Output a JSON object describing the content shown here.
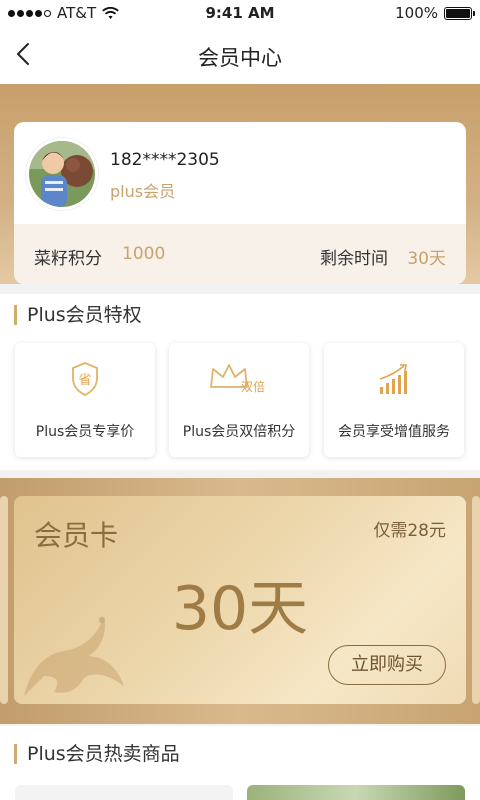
{
  "status_bar": {
    "carrier": "AT&T",
    "time": "9:41 AM",
    "battery": "100%",
    "signal_icon": "signal-dots-icon",
    "wifi_icon": "wifi-icon",
    "battery_icon": "battery-icon"
  },
  "nav": {
    "title": "会员中心",
    "back_icon": "chevron-left-icon"
  },
  "member": {
    "phone": "182****2305",
    "level": "plus会员",
    "points_label": "菜籽积分",
    "points_value": "1000",
    "remaining_label": "剩余时间",
    "remaining_value": "30天"
  },
  "privileges": {
    "title": "Plus会员特权",
    "items": [
      {
        "label": "Plus会员专享价",
        "icon": "shield-save-icon",
        "icon_text": "省"
      },
      {
        "label": "Plus会员双倍积分",
        "icon": "crown-icon",
        "icon_text": "双倍"
      },
      {
        "label": "会员享受增值服务",
        "icon": "growth-chart-icon"
      }
    ]
  },
  "vip_card": {
    "name": "会员卡",
    "price": "仅需28元",
    "days": "30天",
    "buy_label": "立即购买",
    "decoration_icon": "dragon-decoration-icon"
  },
  "hot_products": {
    "title": "Plus会员热卖商品"
  },
  "colors": {
    "gold_accent": "#c9a26c",
    "card_text": "#8a6d3f"
  }
}
